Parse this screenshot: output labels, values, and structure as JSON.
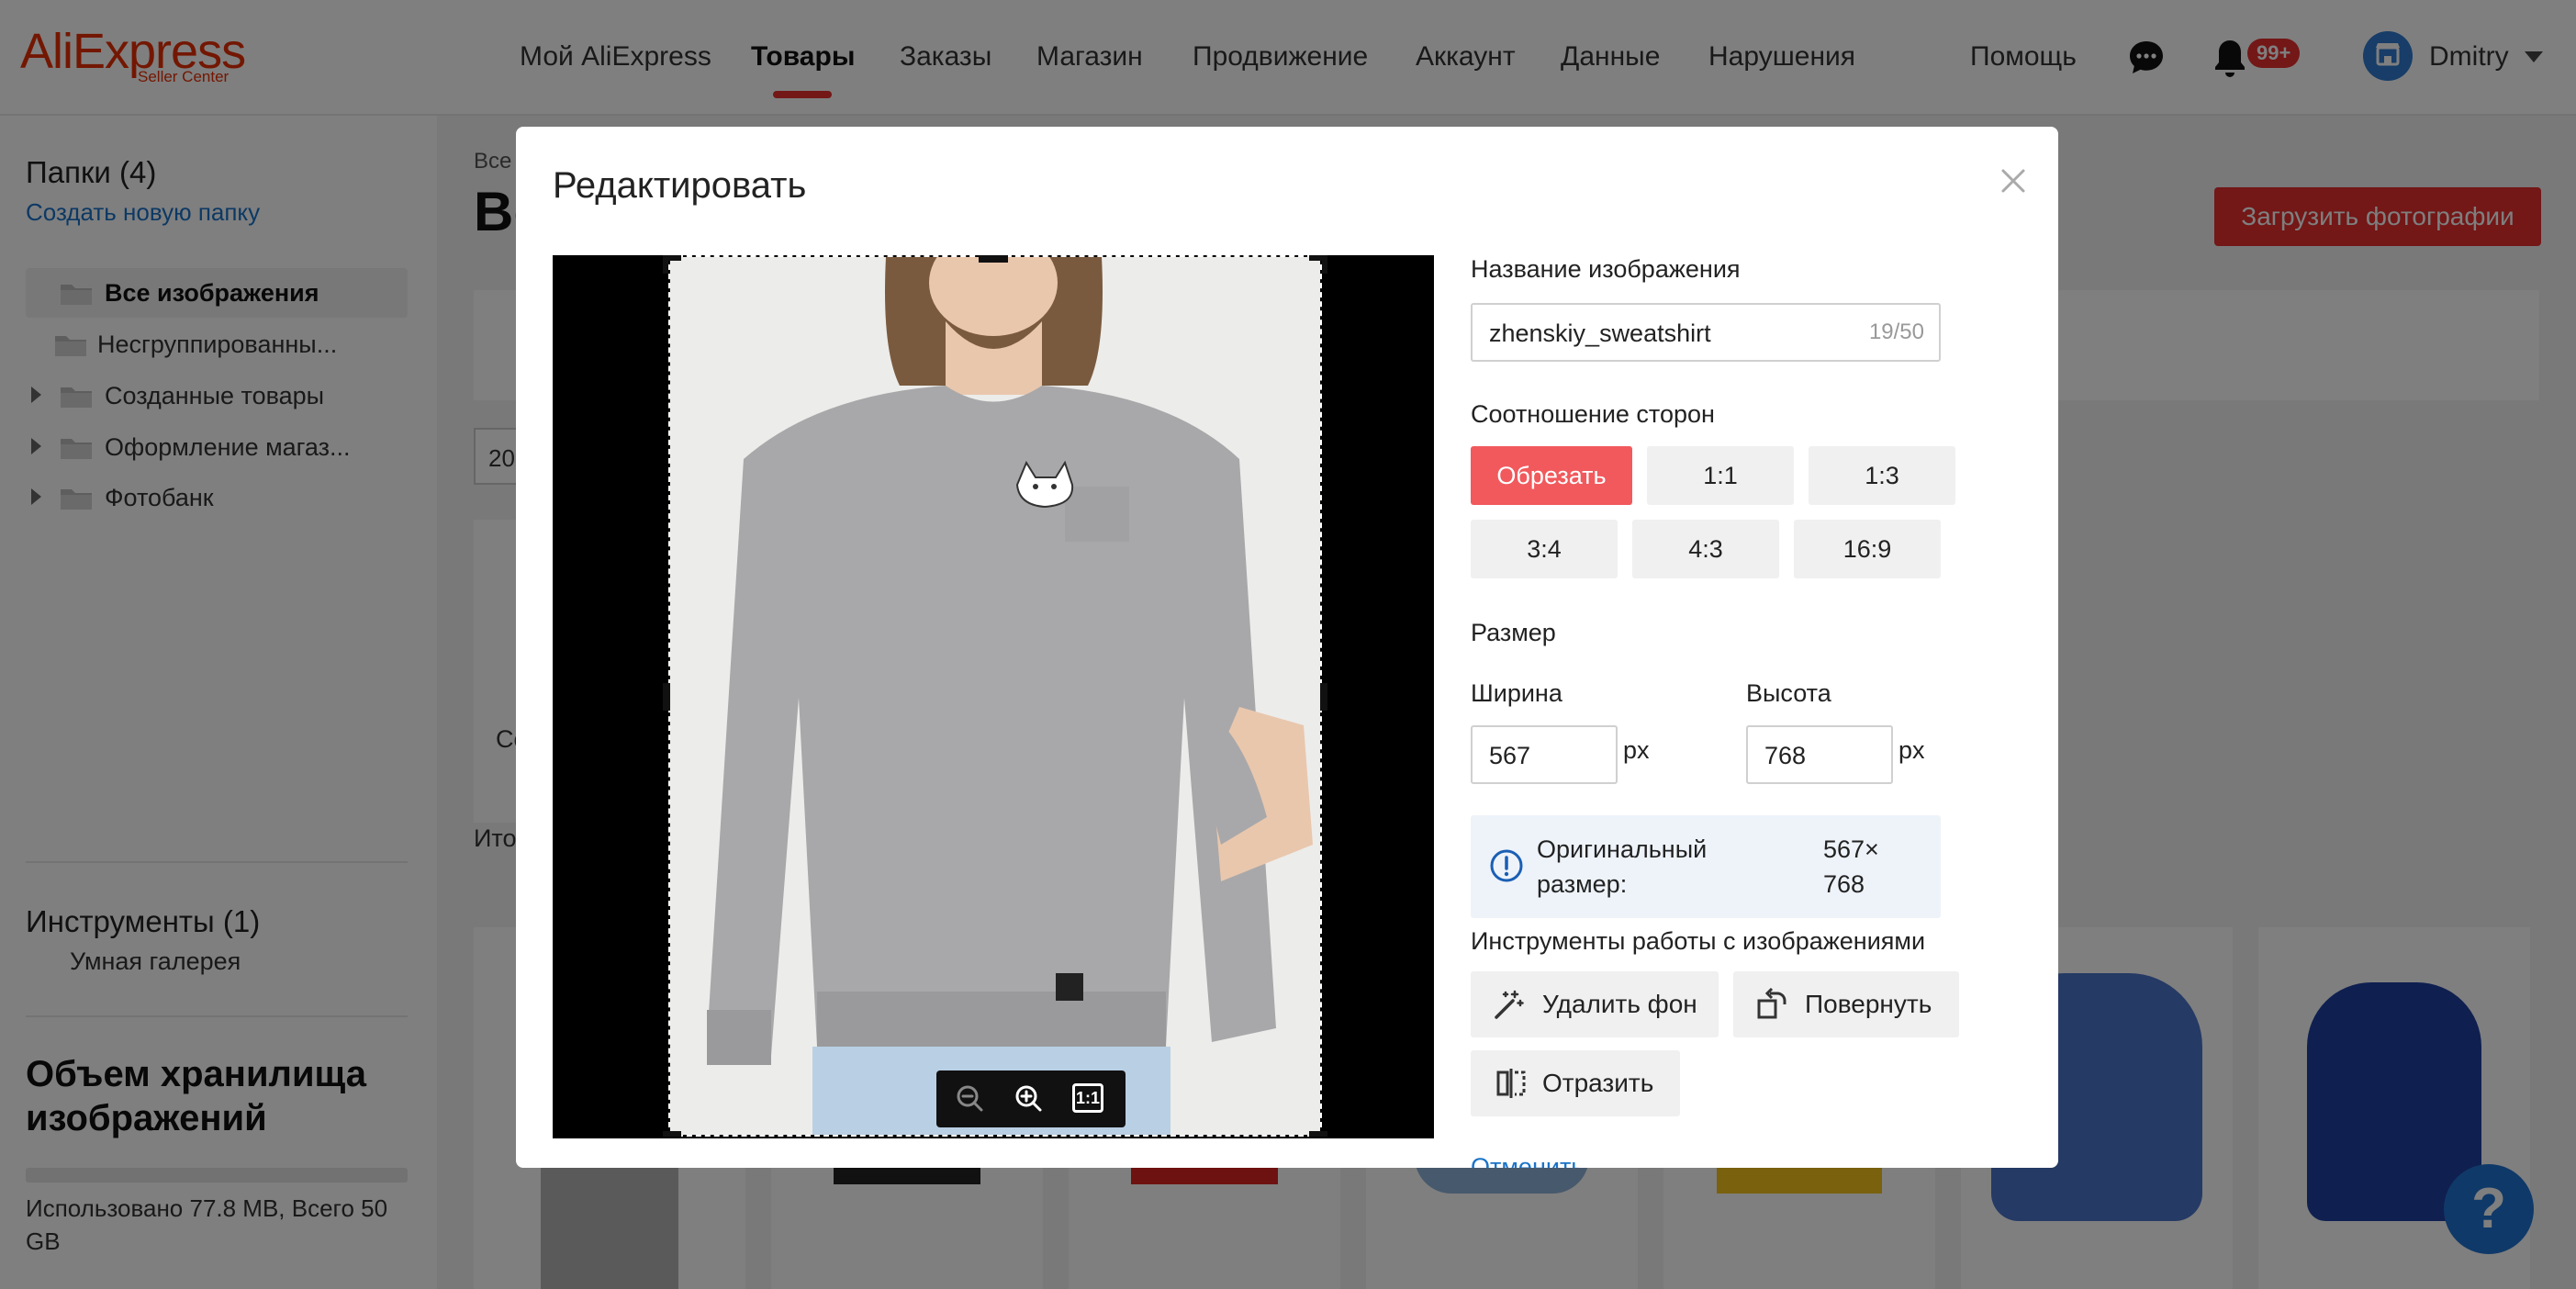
{
  "logo": {
    "main": "AliExpress",
    "sub": "Seller Center"
  },
  "nav": {
    "items": [
      "Мой AliExpress",
      "Товары",
      "Заказы",
      "Магазин",
      "Продвижение",
      "Аккаунт",
      "Данные",
      "Нарушения"
    ],
    "active": "Товары",
    "help": "Помощь",
    "badge": "99+",
    "user": "Dmitry"
  },
  "sidebar": {
    "folders_title": "Папки (4)",
    "create_folder": "Создать новую папку",
    "tree": [
      {
        "label": "Все изображения",
        "selected": true,
        "expandable": false
      },
      {
        "label": "Несгруппированны...",
        "selected": false,
        "expandable": false
      },
      {
        "label": "Созданные товары",
        "selected": false,
        "expandable": true
      },
      {
        "label": "Оформление магаз...",
        "selected": false,
        "expandable": true
      },
      {
        "label": "Фотобанк",
        "selected": false,
        "expandable": true
      }
    ],
    "tools_title": "Инструменты (1)",
    "tools_item": "Умная галерея",
    "storage_title": "Объем хранилища изображений",
    "storage_usage": "Использовано 77.8 MB, Всего 50 GB",
    "storage_used_fraction": 0.0016
  },
  "background": {
    "breadcrumb": "Все",
    "title": "Вс",
    "upload_button": "Загрузить фотографии",
    "date_fragment": "20",
    "card_text": "Со",
    "total_fragment": "Ито"
  },
  "modal": {
    "title": "Редактировать",
    "name_label": "Название изображения",
    "name_value": "zhenskiy_sweatshirt",
    "name_counter": "19/50",
    "ratio_label": "Соотношение сторон",
    "ratios": [
      "Обрезать",
      "1:1",
      "1:3",
      "3:4",
      "4:3",
      "16:9"
    ],
    "active_ratio": "Обрезать",
    "size_label": "Размер",
    "width_label": "Ширина",
    "width_value": "567",
    "height_label": "Высота",
    "height_value": "768",
    "unit": "px",
    "original_label": "Оригинальный размер:",
    "original_value": "567× 768",
    "tools_label": "Инструменты работы с изображениями",
    "tools": [
      "Удалить фон",
      "Повернуть",
      "Отразить"
    ],
    "cancel": "Отменить",
    "zoom_reset": "1:1"
  },
  "colors": {
    "brand": "#e62e04",
    "accent_red": "#e62e2e",
    "active_ratio": "#f1595d",
    "link": "#1a73c8",
    "help": "#1f72d1"
  },
  "icons": [
    "chat-icon",
    "bell-icon",
    "store-icon",
    "caret-down-icon",
    "folder-icon",
    "close-icon",
    "zoom-out-icon",
    "zoom-in-icon",
    "info-icon",
    "magic-wand-icon",
    "rotate-icon",
    "flip-icon",
    "help-icon"
  ]
}
